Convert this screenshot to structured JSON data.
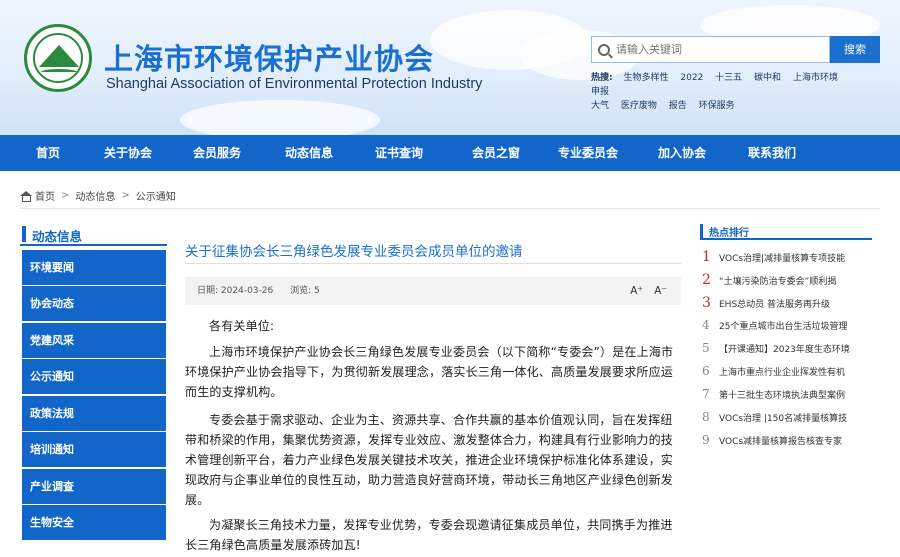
{
  "header": {
    "title_cn": "上海市环境保护产业协会",
    "title_en": "Shanghai Association of Environmental Protection Industry",
    "search_placeholder": "请输入关键词",
    "search_button": "搜索",
    "hot_label": "热搜:",
    "hot_keywords": [
      "生物多样性",
      "2022",
      "十三五",
      "碳中和",
      "上海市环境",
      "申报",
      "大气",
      "医疗废物",
      "报告",
      "环保服务"
    ]
  },
  "nav": [
    "首页",
    "关于协会",
    "会员服务",
    "动态信息",
    "证书查询",
    "会员之窗",
    "专业委员会",
    "加入协会",
    "联系我们"
  ],
  "breadcrumb": [
    "首页",
    "动态信息",
    "公示通知"
  ],
  "sidebar": {
    "title": "动态信息",
    "items": [
      "环境要闻",
      "协会动态",
      "党建风采",
      "公示通知",
      "政策法规",
      "培训通知",
      "产业调查",
      "生物安全"
    ]
  },
  "article": {
    "title": "关于征集协会长三角绿色发展专业委员会成员单位的邀请",
    "date_label": "日期:",
    "date": "2024-03-26",
    "views_label": "浏览:",
    "views": "5",
    "font_up": "A⁺",
    "font_down": "A⁻",
    "greeting": "各有关单位:",
    "paragraphs": [
      "上海市环境保护产业协会长三角绿色发展专业委员会（以下简称“专委会”）是在上海市环境保护产业协会指导下，为贯彻新发展理念，落实长三角一体化、高质量发展要求所应运而生的支撑机构。",
      "专委会基于需求驱动、企业为主、资源共享、合作共赢的基本价值观认同，旨在发挥纽带和桥梁的作用，集聚优势资源，发挥专业效应、激发整体合力，构建具有行业影响力的技术管理创新平台，着力产业绿色发展关键技术攻关，推进企业环境保护标准化体系建设，实现政府与企事业单位的良性互动，助力营造良好营商环境，带动长三角地区产业绿色创新发展。",
      "为凝聚长三角技术力量，发挥专业优势，专委会现邀请征集成员单位，共同携手为推进长三角绿色高质量发展添砖加瓦!"
    ]
  },
  "hot_list": {
    "title": "热点排行",
    "items": [
      {
        "rank": "1",
        "text": "VOCs治理|减排量核算专项技能"
      },
      {
        "rank": "2",
        "text": "“土壤污染防治专委会”顺利揭"
      },
      {
        "rank": "3",
        "text": "EHS总动员 普法服务再升级"
      },
      {
        "rank": "4",
        "text": "25个重点城市出台生活垃圾管理"
      },
      {
        "rank": "5",
        "text": "【开课通知】2023年度生态环境"
      },
      {
        "rank": "6",
        "text": "上海市重点行业企业挥发性有机"
      },
      {
        "rank": "7",
        "text": "第十三批生态环境执法典型案例"
      },
      {
        "rank": "8",
        "text": "VOCs治理 |150名减排量核算技"
      },
      {
        "rank": "9",
        "text": "VOCs减排量核算报告核查专家"
      }
    ]
  },
  "colors": {
    "brand_blue": "#1366c9",
    "title_blue": "#1a6fcf",
    "rank_red": "#d21f1f"
  }
}
